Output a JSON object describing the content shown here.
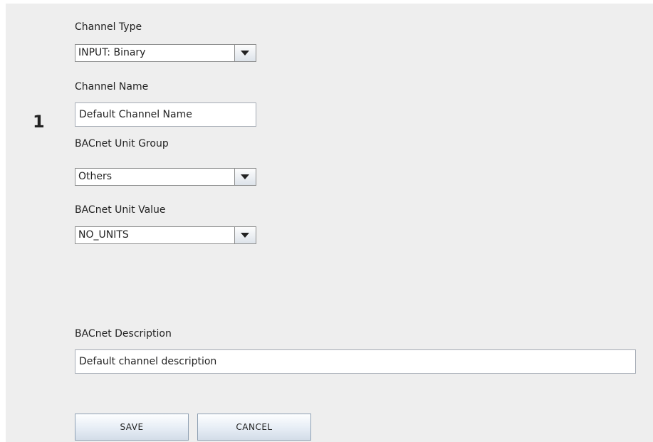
{
  "channel": {
    "number": "1"
  },
  "channel_type": {
    "label": "Channel Type",
    "selected": "INPUT: Binary"
  },
  "channel_name": {
    "label": "Channel Name",
    "value": "Default Channel Name"
  },
  "unit_group": {
    "label": "BACnet Unit Group",
    "selected": "Others"
  },
  "unit_value": {
    "label": "BACnet Unit Value",
    "selected": "NO_UNITS"
  },
  "description": {
    "label": "BACnet Description",
    "value": "Default channel description"
  },
  "buttons": {
    "save_label": "SAVE",
    "cancel_label": "CANCEL"
  },
  "colors": {
    "panel_background": "#eeeeee",
    "button_gradient_top": "#fdfeff",
    "button_gradient_bottom": "#d3dde8"
  },
  "icons": {
    "dropdown": "chevron-down-icon"
  }
}
